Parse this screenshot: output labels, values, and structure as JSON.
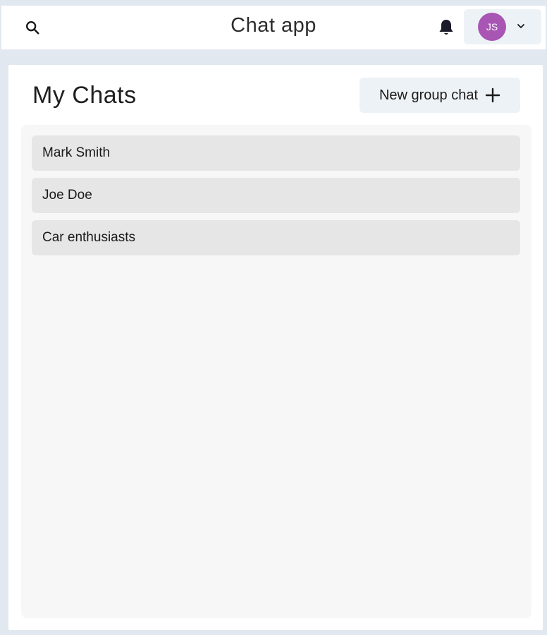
{
  "header": {
    "title": "Chat app",
    "search_icon": "search-icon",
    "notification_icon": "bell-icon",
    "user": {
      "initials": "JS",
      "avatar_color": "#a855b4",
      "menu_icon": "chevron-down-icon"
    }
  },
  "main": {
    "title": "My Chats",
    "new_group_button": {
      "label": "New group chat",
      "icon": "plus-icon"
    },
    "chats": [
      {
        "name": "Mark Smith"
      },
      {
        "name": "Joe Doe"
      },
      {
        "name": "Car enthusiasts"
      }
    ]
  },
  "colors": {
    "background": "#e2e8f0",
    "button_background": "#edf2f7",
    "chat_item_background": "#e6e6e6",
    "list_background": "#f7f7f7"
  }
}
